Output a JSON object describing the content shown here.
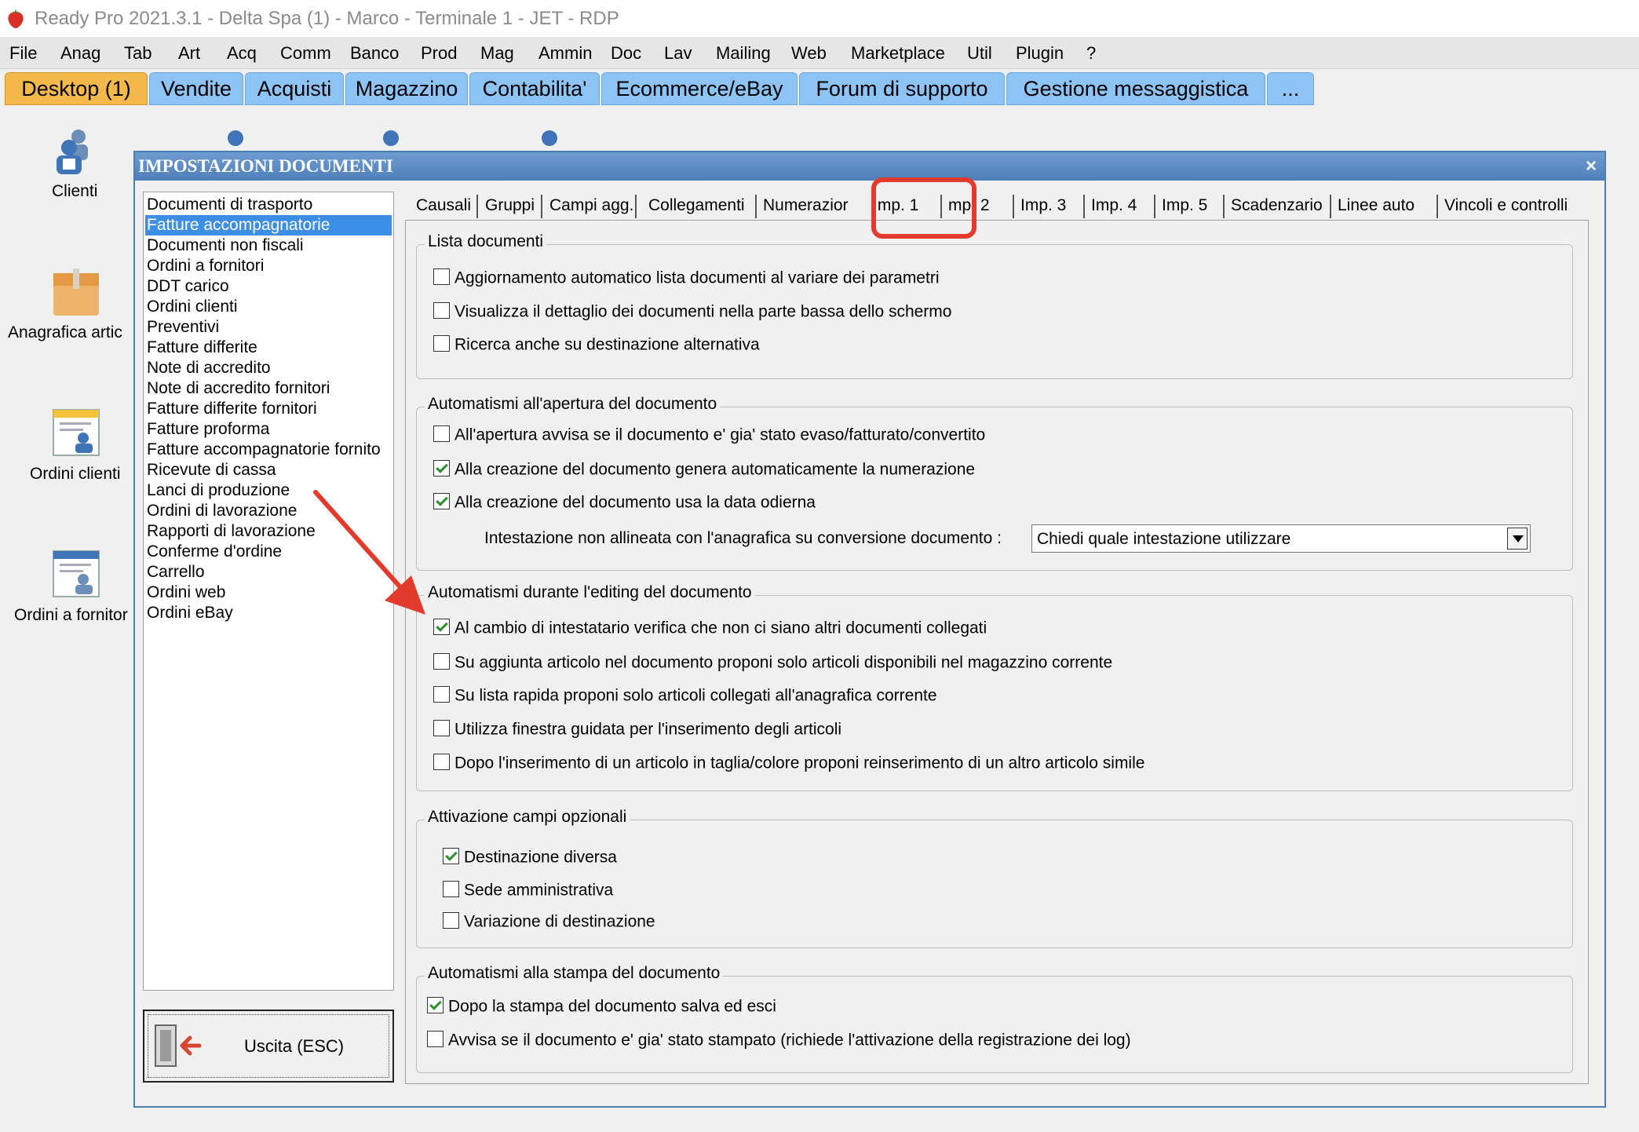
{
  "window": {
    "title": "Ready Pro 2021.3.1 - Delta Spa (1) - Marco - Terminale 1 - JET - RDP"
  },
  "menubar": [
    "File",
    "Anag",
    "Tab",
    "Art",
    "Acq",
    "Comm",
    "Banco",
    "Prod",
    "Mag",
    "Ammin",
    "Doc",
    "Lav",
    "Mailing",
    "Web",
    "Marketplace",
    "Util",
    "Plugin",
    "?"
  ],
  "top_tabs": [
    "Desktop (1)",
    "Vendite",
    "Acquisti",
    "Magazzino",
    "Contabilita'",
    "Ecommerce/eBay",
    "Forum di supporto",
    "Gestione messaggistica",
    "..."
  ],
  "desktop_icons": [
    "Clienti",
    "Anagrafica artic",
    "Ordini clienti",
    "Ordini a fornitor"
  ],
  "dialog": {
    "title": "IMPOSTAZIONI DOCUMENTI",
    "close_glyph": "×",
    "doc_types": [
      "Documenti di trasporto",
      "Fatture accompagnatorie",
      "Documenti non fiscali",
      "Ordini a fornitori",
      "DDT carico",
      "Ordini clienti",
      "Preventivi",
      "Fatture differite",
      "Note di accredito",
      "Note di accredito fornitori",
      "Fatture differite fornitori",
      "Fatture proforma",
      "Fatture accompagnatorie fornito",
      "Ricevute di cassa",
      "Lanci di produzione",
      "Ordini di lavorazione",
      "Rapporti di lavorazione",
      "Conferme d'ordine",
      "Carrello",
      "Ordini web",
      "Ordini eBay"
    ],
    "selected_doc_type": "Fatture accompagnatorie",
    "exit_label": "Uscita (ESC)",
    "tabs": [
      "Causali",
      "Gruppi",
      "Campi agg.",
      "Collegamenti",
      "Numerazior",
      "Imp. 1",
      "mp. 2",
      "Imp. 3",
      "Imp. 4",
      "Imp. 5",
      "Scadenzario",
      "Linee auto",
      "Vincoli e controlli"
    ],
    "active_tab": "Imp. 1",
    "groups": {
      "lista": {
        "title": "Lista documenti",
        "options": [
          {
            "label": "Aggiornamento automatico lista documenti al variare dei parametri",
            "checked": false
          },
          {
            "label": "Visualizza il dettaglio dei documenti nella parte bassa dello schermo",
            "checked": false
          },
          {
            "label": "Ricerca anche su destinazione alternativa",
            "checked": false
          }
        ]
      },
      "apertura": {
        "title": "Automatismi all'apertura del documento",
        "options": [
          {
            "label": "All'apertura avvisa se il documento e' gia' stato evaso/fatturato/convertito",
            "checked": false
          },
          {
            "label": "Alla creazione del documento genera automaticamente la numerazione",
            "checked": true
          },
          {
            "label": "Alla creazione del documento usa la data odierna",
            "checked": true
          }
        ],
        "intestazione_label": "Intestazione non allineata con l'anagrafica su conversione documento :",
        "intestazione_value": "Chiedi quale intestazione utilizzare"
      },
      "editing": {
        "title": "Automatismi durante l'editing del documento",
        "options": [
          {
            "label": "Al cambio di intestatario verifica che non ci siano altri documenti collegati",
            "checked": true
          },
          {
            "label": "Su aggiunta articolo nel documento proponi solo articoli disponibili nel magazzino corrente",
            "checked": false
          },
          {
            "label": "Su lista rapida proponi solo articoli collegati all'anagrafica corrente",
            "checked": false
          },
          {
            "label": "Utilizza finestra guidata per l'inserimento degli articoli",
            "checked": false
          },
          {
            "label": "Dopo l'inserimento di un articolo in taglia/colore proponi reinserimento di un altro articolo simile",
            "checked": false
          }
        ]
      },
      "campi": {
        "title": "Attivazione campi opzionali",
        "options": [
          {
            "label": "Destinazione diversa",
            "checked": true
          },
          {
            "label": "Sede amministrativa",
            "checked": false
          },
          {
            "label": "Variazione di destinazione",
            "checked": false
          }
        ]
      },
      "stampa": {
        "title": "Automatismi alla stampa del documento",
        "options": [
          {
            "label": "Dopo la stampa del documento salva ed esci",
            "checked": true
          },
          {
            "label": "Avvisa se il documento e' gia' stato stampato (richiede l'attivazione della registrazione dei log)",
            "checked": false
          }
        ]
      }
    }
  },
  "colors": {
    "accent_tab": "#8dc3f5",
    "active_tab": "#f5b94b",
    "selection": "#3d8ee6",
    "annotation": "#e23b2e",
    "check": "#2a8f2a"
  },
  "icons": [
    "app-strawberry-icon",
    "clienti-icon",
    "box-icon",
    "ordini-clienti-icon",
    "ordini-fornitori-icon",
    "exit-door-icon",
    "dropdown-arrow-icon",
    "annotation-arrow"
  ]
}
